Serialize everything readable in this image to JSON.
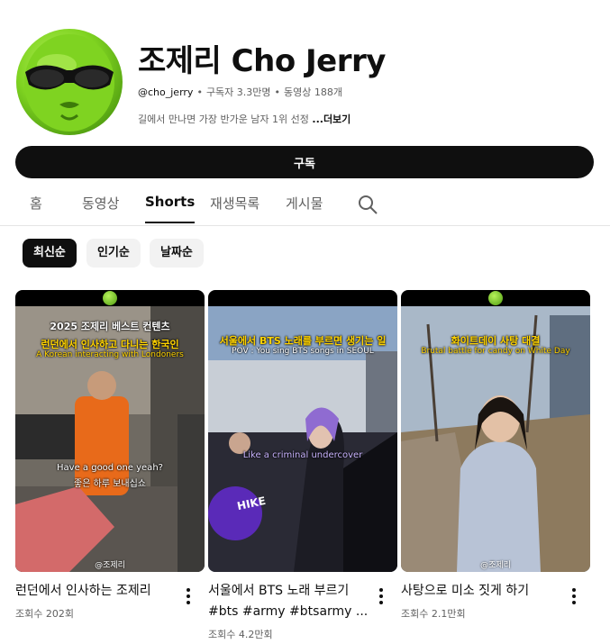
{
  "channel": {
    "name": "조제리 Cho Jerry",
    "handle": "@cho_jerry",
    "subscribers": "구독자 3.3만명",
    "videos": "동영상 188개",
    "description": "길에서 만나면 가장 반가운 남자 1위 선정",
    "more_label": "...더보기",
    "subscribe_label": "구독"
  },
  "tabs": [
    "홈",
    "동영상",
    "Shorts",
    "재생목록",
    "게시물"
  ],
  "active_tab": "Shorts",
  "chips": [
    "최신순",
    "인기순",
    "날짜순"
  ],
  "active_chip": "최신순",
  "shorts": [
    {
      "title": "런던에서 인사하는 조제리",
      "views": "조회수 202회",
      "overlay_title": "2025 조제리 베스트 컨텐츠",
      "overlay_main": "런던에서 인사하고 다니는 한국인",
      "overlay_sub": "A Korean interacting with Londoners",
      "caption_1": "Have a good one yeah?",
      "caption_2": "좋은 하루 보내십쇼",
      "watermark": "@조제리"
    },
    {
      "title_line1": "서울에서 BTS 노래 부르기",
      "title_line2": "#bts #army #btsarmy ...",
      "views": "조회수 4.2만회",
      "overlay_main": "서울에서 BTS 노래를 부르면 생기는 일",
      "overlay_sub": "POV : You sing BTS songs in SEOUL",
      "caption_1": "Like a criminal undercover",
      "balloon_text": "HIKE"
    },
    {
      "title": "사탕으로 미소 짓게 하기",
      "views": "조회수 2.1만회",
      "overlay_main": "화이트데이 사탕 대결",
      "overlay_sub": "Brutal battle for candy on White Day",
      "watermark": "@조제리"
    }
  ],
  "colors": {
    "brand_dark": "#0f0f0f",
    "secondary_text": "#606060",
    "chip_bg": "#f2f2f2",
    "overlay_yellow": "#ffd300",
    "avatar_green": "#7fd321"
  },
  "icons": [
    "alien-avatar",
    "search-icon",
    "more-vert-icon"
  ]
}
